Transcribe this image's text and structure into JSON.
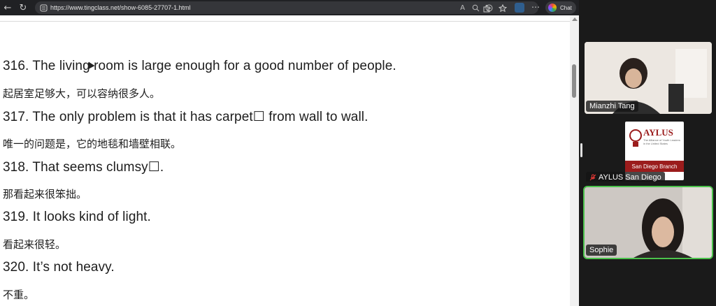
{
  "browser": {
    "url": "https://www.tingclass.net/show-6085-27707-1.html",
    "chat_label": "Chat"
  },
  "content": {
    "lines": [
      {
        "kind": "en",
        "text": "316. The living room is large enough for a good number of people."
      },
      {
        "kind": "zh",
        "text": "起居室足够大，可以容纳很多人。"
      },
      {
        "kind": "en",
        "text": "317. The only problem is that it has carpet☐ from wall to wall."
      },
      {
        "kind": "zh",
        "text": "唯一的问题是，它的地毯和墙壁相联。"
      },
      {
        "kind": "en",
        "text": "318. That seems clumsy☐."
      },
      {
        "kind": "zh",
        "text": "那看起来很笨拙。"
      },
      {
        "kind": "en",
        "text": "319. It looks kind of light."
      },
      {
        "kind": "zh",
        "text": "看起来很轻。"
      },
      {
        "kind": "en",
        "text": "320. It’s not heavy."
      },
      {
        "kind": "zh",
        "text": "不重。"
      }
    ]
  },
  "call": {
    "participants": [
      {
        "name": "Mianzhi Tang",
        "muted": false
      },
      {
        "name": "AYLUS San Diego",
        "muted": true
      },
      {
        "name": "Sophie",
        "muted": false,
        "active_speaker": true
      }
    ],
    "aylus_logo": {
      "org": "AYLUS",
      "tagline": "The Alliance of Youth Leaders in the United States",
      "branch": "San Diego Branch"
    }
  },
  "icons": {
    "back": "arrow-left-icon",
    "refresh": "refresh-icon",
    "site_info": "site-info-icon",
    "translate": "translate-icon",
    "zoom": "zoom-icon",
    "reading": "reading-mode-icon",
    "favorite": "star-icon",
    "extensions": "puzzle-icon",
    "collections": "collections-icon",
    "profile": "profile-icon",
    "menu": "more-icon",
    "mic_muted": "mic-muted-icon"
  },
  "colors": {
    "active_speaker_border": "#4cc34c",
    "aylus_red": "#9b1c1c"
  }
}
